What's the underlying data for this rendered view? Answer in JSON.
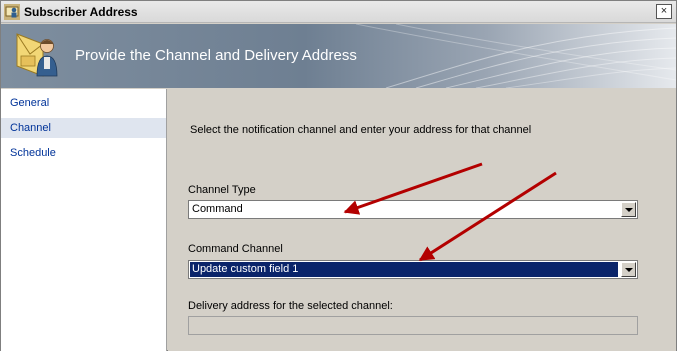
{
  "window": {
    "title": "Subscriber Address",
    "close_glyph": "×"
  },
  "banner": {
    "title": "Provide the Channel and Delivery Address",
    "icon": "subscriber-icon"
  },
  "nav": {
    "items": [
      {
        "label": "General"
      },
      {
        "label": "Channel"
      },
      {
        "label": "Schedule"
      }
    ]
  },
  "content": {
    "instruction": "Select the notification channel and enter your address for that channel",
    "channel_type": {
      "label": "Channel Type",
      "value": "Command"
    },
    "command_channel": {
      "label": "Command Channel",
      "value": "Update custom field 1"
    },
    "delivery_address": {
      "label": "Delivery address for the selected channel:",
      "value": ""
    }
  },
  "colors": {
    "annotation_arrow": "#b30000",
    "selection": "#0a246a",
    "nav_link": "#003399"
  }
}
